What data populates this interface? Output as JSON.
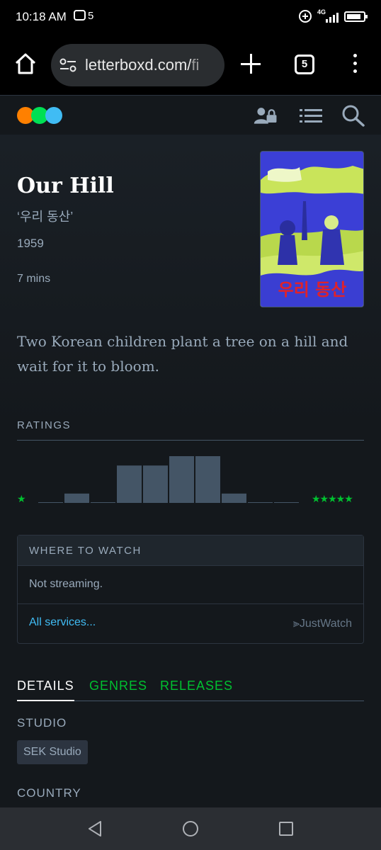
{
  "status_bar": {
    "time": "10:18 AM",
    "notification_count": "5",
    "network": "4G"
  },
  "browser": {
    "url_main": "letterboxd.com/",
    "url_rest": "fi",
    "tab_count": "5"
  },
  "film": {
    "title": "Our Hill",
    "original_title": "‘우리 동산’",
    "year": "1959",
    "runtime": "7 mins",
    "poster_title": "우리 동산",
    "tagline": "Two Korean children plant a tree on a hill and wait for it to bloom."
  },
  "ratings": {
    "heading": "RATINGS",
    "low_label": "★",
    "high_label": "★★★★★",
    "histogram": [
      0,
      0.2,
      0,
      0.8,
      0.8,
      1.0,
      1.0,
      0.2,
      0,
      0
    ]
  },
  "where_to_watch": {
    "heading": "WHERE TO WATCH",
    "status": "Not streaming.",
    "all_services": "All services...",
    "provider": "JustWatch"
  },
  "tabs": [
    "DETAILS",
    "GENRES",
    "RELEASES"
  ],
  "details": {
    "studio_label": "STUDIO",
    "studio": "SEK Studio",
    "country_label": "COUNTRY"
  },
  "colors": {
    "background": "#14181c",
    "accent_green": "#00c030",
    "link_blue": "#40bcf4",
    "logo_orange": "#ff8000",
    "logo_green": "#00e054",
    "logo_blue": "#40bcf4"
  },
  "icons": [
    "home-icon",
    "tune-icon",
    "plus-icon",
    "tab-switcher-icon",
    "more-vert-icon",
    "letterboxd-logo",
    "profile-lock-icon",
    "menu-icon",
    "search-icon"
  ]
}
